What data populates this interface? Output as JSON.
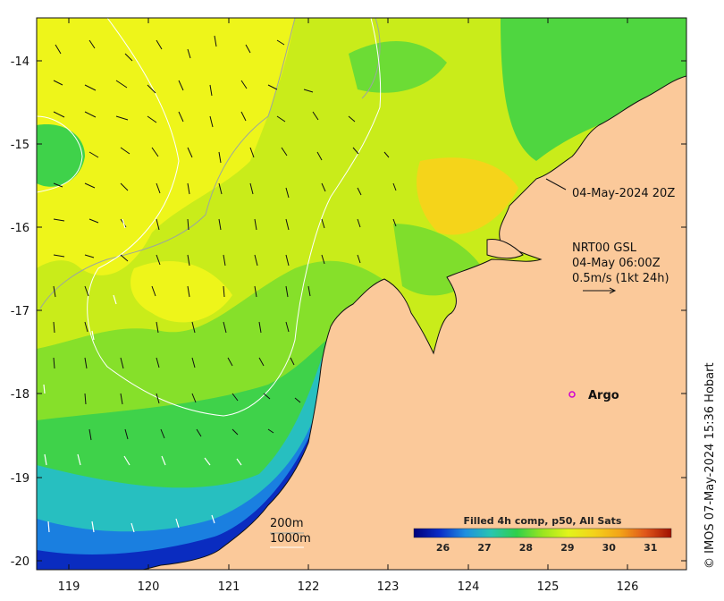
{
  "map": {
    "lon_ticks": [
      "119",
      "120",
      "121",
      "122",
      "123",
      "124",
      "125",
      "126"
    ],
    "lat_ticks": [
      "-14",
      "-15",
      "-16",
      "-17",
      "-18",
      "-19",
      "-20"
    ],
    "land_color": "#fbc99a",
    "ocean_palette": [
      "#00007a",
      "#0a2cc8",
      "#1f8fe0",
      "#29c5b0",
      "#2fd04a",
      "#9ae51f",
      "#e2f41a",
      "#f4d21a",
      "#f3a418"
    ]
  },
  "annotations": {
    "image_time": "04-May-2024 20Z",
    "current_source": "NRT00 GSL",
    "current_time": "04-May 06:00Z",
    "current_scale": "0.5m/s (1kt 24h)",
    "argo_label": "Argo",
    "contour_200": "200m",
    "contour_1000": "1000m",
    "credit": "© IMOS 07-May-2024 15:36 Hobart"
  },
  "colorbar": {
    "title": "Filled 4h comp, p50, All Sats",
    "ticks": [
      "26",
      "27",
      "28",
      "29",
      "30",
      "31"
    ],
    "min": 25.3,
    "max": 31.5,
    "colors": [
      "#00007a",
      "#0a2cc8",
      "#1f8fe0",
      "#29c5b0",
      "#2fd04a",
      "#9ae51f",
      "#e2f41a",
      "#f4d21a",
      "#f3a418",
      "#e0561a",
      "#a01000"
    ]
  }
}
